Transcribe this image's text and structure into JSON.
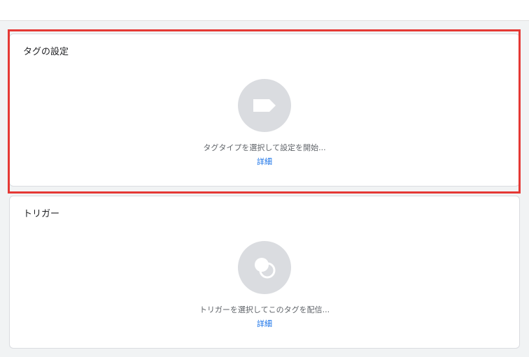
{
  "tag_config": {
    "title": "タグの設定",
    "icon": "tag-icon",
    "hint": "タグタイプを選択して設定を開始...",
    "link": "詳細"
  },
  "trigger": {
    "title": "トリガー",
    "icon": "trigger-circles-icon",
    "hint": "トリガーを選択してこのタグを配信...",
    "link": "詳細"
  },
  "colors": {
    "highlight": "#e53935",
    "link": "#1a73e8",
    "icon_circle": "#dadce0"
  }
}
